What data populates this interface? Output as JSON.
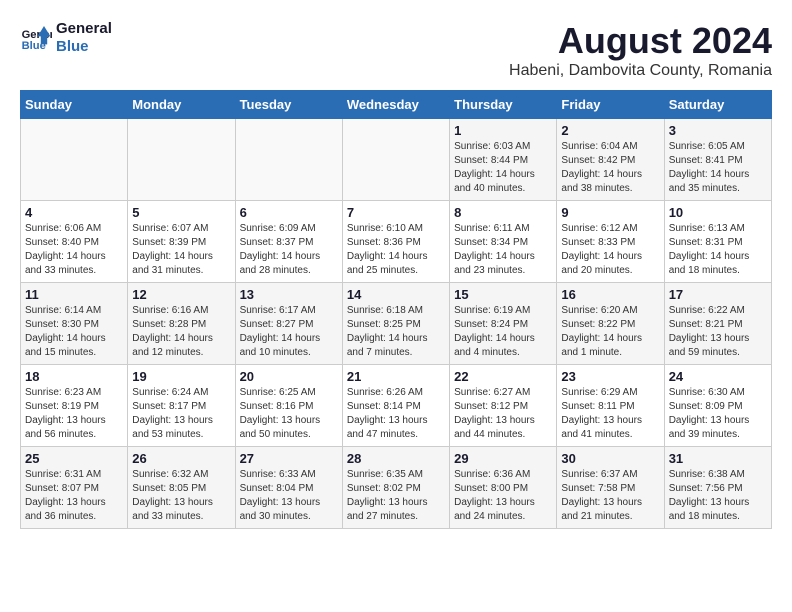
{
  "logo": {
    "line1": "General",
    "line2": "Blue"
  },
  "title": "August 2024",
  "subtitle": "Habeni, Dambovita County, Romania",
  "weekdays": [
    "Sunday",
    "Monday",
    "Tuesday",
    "Wednesday",
    "Thursday",
    "Friday",
    "Saturday"
  ],
  "weeks": [
    [
      {
        "day": "",
        "info": ""
      },
      {
        "day": "",
        "info": ""
      },
      {
        "day": "",
        "info": ""
      },
      {
        "day": "",
        "info": ""
      },
      {
        "day": "1",
        "info": "Sunrise: 6:03 AM\nSunset: 8:44 PM\nDaylight: 14 hours\nand 40 minutes."
      },
      {
        "day": "2",
        "info": "Sunrise: 6:04 AM\nSunset: 8:42 PM\nDaylight: 14 hours\nand 38 minutes."
      },
      {
        "day": "3",
        "info": "Sunrise: 6:05 AM\nSunset: 8:41 PM\nDaylight: 14 hours\nand 35 minutes."
      }
    ],
    [
      {
        "day": "4",
        "info": "Sunrise: 6:06 AM\nSunset: 8:40 PM\nDaylight: 14 hours\nand 33 minutes."
      },
      {
        "day": "5",
        "info": "Sunrise: 6:07 AM\nSunset: 8:39 PM\nDaylight: 14 hours\nand 31 minutes."
      },
      {
        "day": "6",
        "info": "Sunrise: 6:09 AM\nSunset: 8:37 PM\nDaylight: 14 hours\nand 28 minutes."
      },
      {
        "day": "7",
        "info": "Sunrise: 6:10 AM\nSunset: 8:36 PM\nDaylight: 14 hours\nand 25 minutes."
      },
      {
        "day": "8",
        "info": "Sunrise: 6:11 AM\nSunset: 8:34 PM\nDaylight: 14 hours\nand 23 minutes."
      },
      {
        "day": "9",
        "info": "Sunrise: 6:12 AM\nSunset: 8:33 PM\nDaylight: 14 hours\nand 20 minutes."
      },
      {
        "day": "10",
        "info": "Sunrise: 6:13 AM\nSunset: 8:31 PM\nDaylight: 14 hours\nand 18 minutes."
      }
    ],
    [
      {
        "day": "11",
        "info": "Sunrise: 6:14 AM\nSunset: 8:30 PM\nDaylight: 14 hours\nand 15 minutes."
      },
      {
        "day": "12",
        "info": "Sunrise: 6:16 AM\nSunset: 8:28 PM\nDaylight: 14 hours\nand 12 minutes."
      },
      {
        "day": "13",
        "info": "Sunrise: 6:17 AM\nSunset: 8:27 PM\nDaylight: 14 hours\nand 10 minutes."
      },
      {
        "day": "14",
        "info": "Sunrise: 6:18 AM\nSunset: 8:25 PM\nDaylight: 14 hours\nand 7 minutes."
      },
      {
        "day": "15",
        "info": "Sunrise: 6:19 AM\nSunset: 8:24 PM\nDaylight: 14 hours\nand 4 minutes."
      },
      {
        "day": "16",
        "info": "Sunrise: 6:20 AM\nSunset: 8:22 PM\nDaylight: 14 hours\nand 1 minute."
      },
      {
        "day": "17",
        "info": "Sunrise: 6:22 AM\nSunset: 8:21 PM\nDaylight: 13 hours\nand 59 minutes."
      }
    ],
    [
      {
        "day": "18",
        "info": "Sunrise: 6:23 AM\nSunset: 8:19 PM\nDaylight: 13 hours\nand 56 minutes."
      },
      {
        "day": "19",
        "info": "Sunrise: 6:24 AM\nSunset: 8:17 PM\nDaylight: 13 hours\nand 53 minutes."
      },
      {
        "day": "20",
        "info": "Sunrise: 6:25 AM\nSunset: 8:16 PM\nDaylight: 13 hours\nand 50 minutes."
      },
      {
        "day": "21",
        "info": "Sunrise: 6:26 AM\nSunset: 8:14 PM\nDaylight: 13 hours\nand 47 minutes."
      },
      {
        "day": "22",
        "info": "Sunrise: 6:27 AM\nSunset: 8:12 PM\nDaylight: 13 hours\nand 44 minutes."
      },
      {
        "day": "23",
        "info": "Sunrise: 6:29 AM\nSunset: 8:11 PM\nDaylight: 13 hours\nand 41 minutes."
      },
      {
        "day": "24",
        "info": "Sunrise: 6:30 AM\nSunset: 8:09 PM\nDaylight: 13 hours\nand 39 minutes."
      }
    ],
    [
      {
        "day": "25",
        "info": "Sunrise: 6:31 AM\nSunset: 8:07 PM\nDaylight: 13 hours\nand 36 minutes."
      },
      {
        "day": "26",
        "info": "Sunrise: 6:32 AM\nSunset: 8:05 PM\nDaylight: 13 hours\nand 33 minutes."
      },
      {
        "day": "27",
        "info": "Sunrise: 6:33 AM\nSunset: 8:04 PM\nDaylight: 13 hours\nand 30 minutes."
      },
      {
        "day": "28",
        "info": "Sunrise: 6:35 AM\nSunset: 8:02 PM\nDaylight: 13 hours\nand 27 minutes."
      },
      {
        "day": "29",
        "info": "Sunrise: 6:36 AM\nSunset: 8:00 PM\nDaylight: 13 hours\nand 24 minutes."
      },
      {
        "day": "30",
        "info": "Sunrise: 6:37 AM\nSunset: 7:58 PM\nDaylight: 13 hours\nand 21 minutes."
      },
      {
        "day": "31",
        "info": "Sunrise: 6:38 AM\nSunset: 7:56 PM\nDaylight: 13 hours\nand 18 minutes."
      }
    ]
  ]
}
